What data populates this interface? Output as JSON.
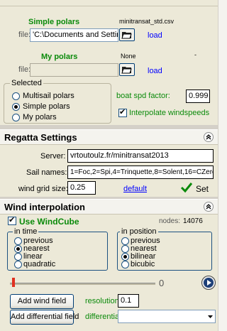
{
  "polars": {
    "simple": {
      "title": "Simple polars",
      "file_name": "minitransat_std.csv",
      "file_label": "file:",
      "file_value": "'C:\\Documents and Settin",
      "load_label": "load"
    },
    "my": {
      "title": "My polars",
      "file_name": "None",
      "dash": "-",
      "file_label": "file:",
      "file_value": "",
      "load_label": "load"
    },
    "selected": {
      "title": "Selected",
      "options": [
        "Multisail polars",
        "Simple polars",
        "My polars"
      ],
      "selected_index": 1
    },
    "boat_spd_factor": {
      "label": "boat spd factor:",
      "value": "0.999"
    },
    "interpolate_windspeeds": {
      "label": "Interpolate windspeeds",
      "checked": true
    }
  },
  "regatta": {
    "title": "Regatta Settings",
    "server_label": "Server:",
    "server_value": "vrtoutoulz.fr/minitransat2013",
    "sail_names_label": "Sail names:",
    "sail_names_value": "1=Foc,2=Spi,4=Trinquette,8=Solent,16=CZero,32=",
    "wind_grid_label": "wind grid size:",
    "wind_grid_value": "0.25",
    "default_label": "default",
    "set_label": "Set"
  },
  "wind": {
    "title": "Wind interpolation",
    "use_windcube_label": "Use WindCube",
    "use_windcube_checked": true,
    "nodes_label": "nodes:",
    "nodes_value": "14076",
    "in_time": {
      "title": "in time",
      "options": [
        "previous",
        "nearest",
        "linear",
        "quadratic"
      ],
      "selected_index": 1
    },
    "in_position": {
      "title": "in position",
      "options": [
        "previous",
        "nearest",
        "bilinear",
        "bicubic"
      ],
      "selected_index": 2
    },
    "slider_value": "0",
    "add_wind_field_label": "Add wind field",
    "resolution_label": "resolution:",
    "resolution_value": "0.1",
    "add_differential_label": "Add differential field",
    "differential_label": "differential:",
    "differential_value": ""
  },
  "colors": {
    "accent_green": "#0a8a0a",
    "link_blue": "#0000ff",
    "panel_bg": "#ece9d8"
  }
}
